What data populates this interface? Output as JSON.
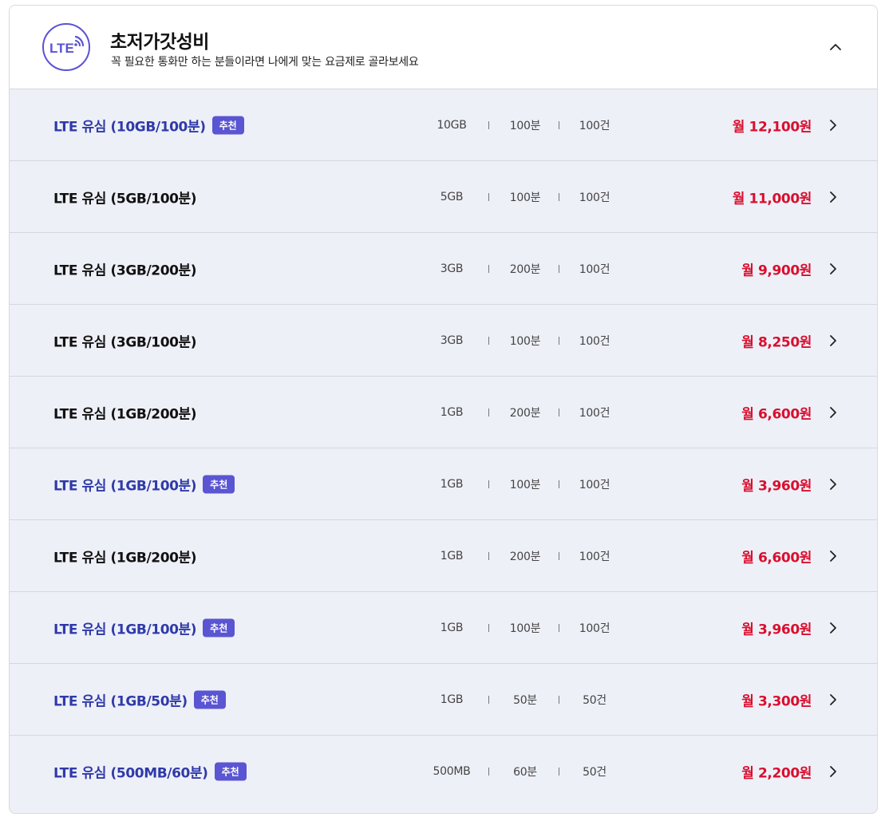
{
  "header": {
    "logo_text": "LTE",
    "title": "초저가갓성비",
    "subtitle": "꼭 필요한 통화만 하는 분들이라면 나에게 맞는 요금제로 골라보세요"
  },
  "colors": {
    "accent": "#5a55d2",
    "recommended_name": "#2f3aa8",
    "price": "#d90f2e",
    "row_bg": "#eef0f8"
  },
  "plans": [
    {
      "name": "LTE 유심 (10GB/100분)",
      "badge": "추천",
      "data": "10GB",
      "voice": "100분",
      "sms": "100건",
      "price": "월 12,100원"
    },
    {
      "name": "LTE 유심 (5GB/100분)",
      "badge": "",
      "data": "5GB",
      "voice": "100분",
      "sms": "100건",
      "price": "월 11,000원"
    },
    {
      "name": "LTE 유심 (3GB/200분)",
      "badge": "",
      "data": "3GB",
      "voice": "200분",
      "sms": "100건",
      "price": "월 9,900원"
    },
    {
      "name": "LTE 유심 (3GB/100분)",
      "badge": "",
      "data": "3GB",
      "voice": "100분",
      "sms": "100건",
      "price": "월 8,250원"
    },
    {
      "name": "LTE 유심 (1GB/200분)",
      "badge": "",
      "data": "1GB",
      "voice": "200분",
      "sms": "100건",
      "price": "월 6,600원"
    },
    {
      "name": "LTE 유심 (1GB/100분)",
      "badge": "추천",
      "data": "1GB",
      "voice": "100분",
      "sms": "100건",
      "price": "월 3,960원"
    },
    {
      "name": "LTE 유심 (1GB/200분)",
      "badge": "",
      "data": "1GB",
      "voice": "200분",
      "sms": "100건",
      "price": "월 6,600원"
    },
    {
      "name": "LTE 유심 (1GB/100분)",
      "badge": "추천",
      "data": "1GB",
      "voice": "100분",
      "sms": "100건",
      "price": "월 3,960원"
    },
    {
      "name": "LTE 유심 (1GB/50분)",
      "badge": "추천",
      "data": "1GB",
      "voice": "50분",
      "sms": "50건",
      "price": "월 3,300원"
    },
    {
      "name": "LTE 유심 (500MB/60분)",
      "badge": "추천",
      "data": "500MB",
      "voice": "60분",
      "sms": "50건",
      "price": "월 2,200원"
    }
  ],
  "icons": {
    "logo": "lte-signal-icon",
    "collapse": "chevron-up-icon",
    "row_arrow": "chevron-right-icon"
  }
}
